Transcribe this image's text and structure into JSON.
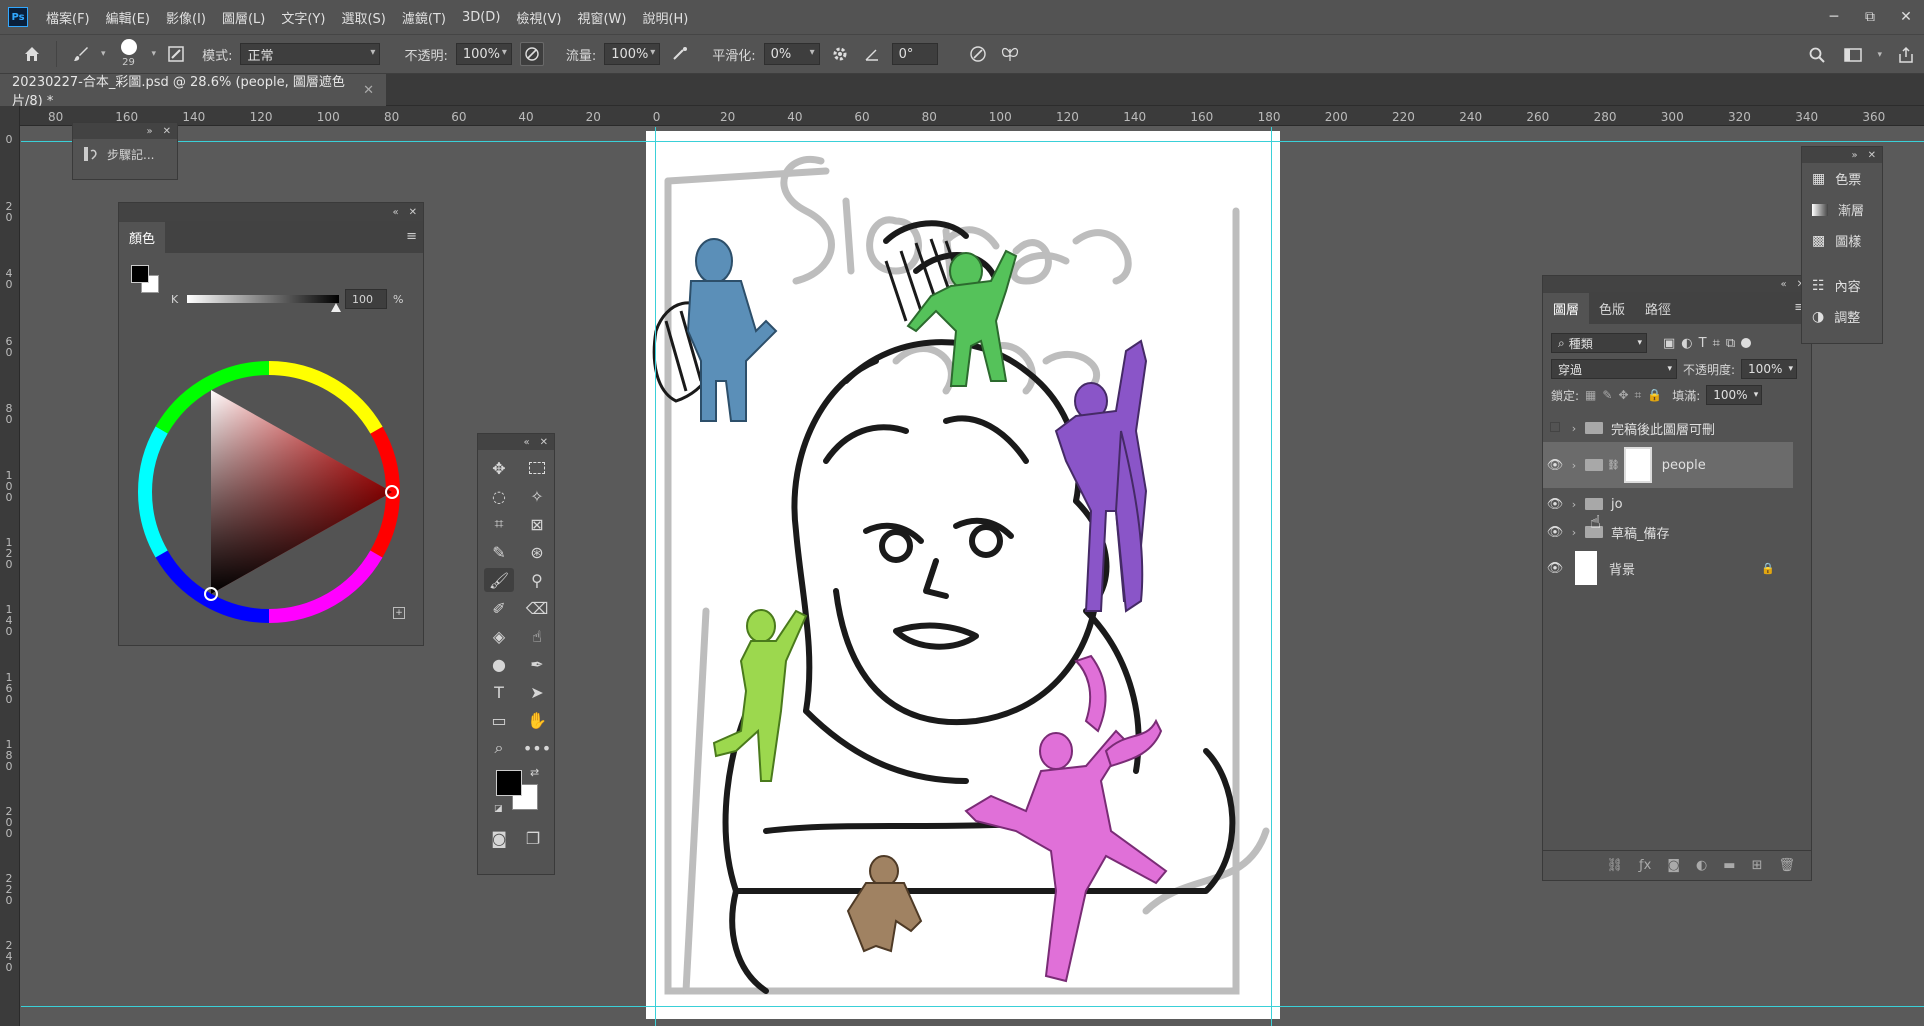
{
  "menu": {
    "logo": "Ps",
    "items": [
      "檔案(F)",
      "編輯(E)",
      "影像(I)",
      "圖層(L)",
      "文字(Y)",
      "選取(S)",
      "濾鏡(T)",
      "3D(D)",
      "檢視(V)",
      "視窗(W)",
      "說明(H)"
    ]
  },
  "window": {
    "minimize": "─",
    "restore": "⧉",
    "close": "✕"
  },
  "options": {
    "brush_size": "29",
    "mode_label": "模式:",
    "mode_value": "正常",
    "opacity_label": "不透明:",
    "opacity_value": "100%",
    "flow_label": "流量:",
    "flow_value": "100%",
    "smoothing_label": "平滑化:",
    "smoothing_value": "0%",
    "angle_value": "0°"
  },
  "document": {
    "tab_title": "20230227-合本_彩圖.psd @ 28.6% (people, 圖層遮色片/8) *",
    "close": "✕"
  },
  "ruler": {
    "top_ticks": [
      "80",
      "160",
      "140",
      "120",
      "100",
      "80",
      "60",
      "40",
      "20",
      "0",
      "20",
      "40",
      "60",
      "80",
      "100",
      "120",
      "140",
      "160",
      "180",
      "200",
      "220",
      "240",
      "260",
      "280",
      "300",
      "320",
      "340",
      "360"
    ],
    "left_ticks": [
      "0",
      "2 0",
      "4 0",
      "6 0",
      "8 0",
      "1 0 0",
      "1 2 0",
      "1 4 0",
      "1 6 0",
      "1 8 0",
      "2 0 0",
      "2 2 0",
      "2 4 0"
    ]
  },
  "history_panel": {
    "label": "步驟記..."
  },
  "color_panel": {
    "tab": "顏色",
    "channel": "K",
    "value": "100",
    "unit": "%"
  },
  "layers_panel": {
    "tabs": [
      "圖層",
      "色版",
      "路徑"
    ],
    "filter_kind": "種類",
    "blend_mode": "穿過",
    "opacity_label": "不透明度:",
    "opacity_value": "100%",
    "lock_label": "鎖定:",
    "fill_label": "填滿:",
    "fill_value": "100%",
    "layers": [
      {
        "name": "完稿後此圖層可刪",
        "visible": false,
        "type": "group"
      },
      {
        "name": "people",
        "visible": true,
        "type": "group-mask",
        "selected": true
      },
      {
        "name": "jo",
        "visible": true,
        "type": "group"
      },
      {
        "name": "草稿_備存",
        "visible": true,
        "type": "group"
      },
      {
        "name": "背景",
        "visible": true,
        "type": "background"
      }
    ]
  },
  "right_dock": {
    "items": [
      "色票",
      "漸層",
      "圖樣",
      "內容",
      "調整"
    ]
  },
  "colors": {
    "accent": "#31a8ff",
    "guide": "#3ad0d8",
    "blue_figure": "#5b8fb8",
    "green_figure": "#55c25a",
    "purple_figure": "#8a55c8",
    "lime_figure": "#9cd84e",
    "pink_figure": "#e070d8",
    "brown_figure": "#a08262"
  }
}
